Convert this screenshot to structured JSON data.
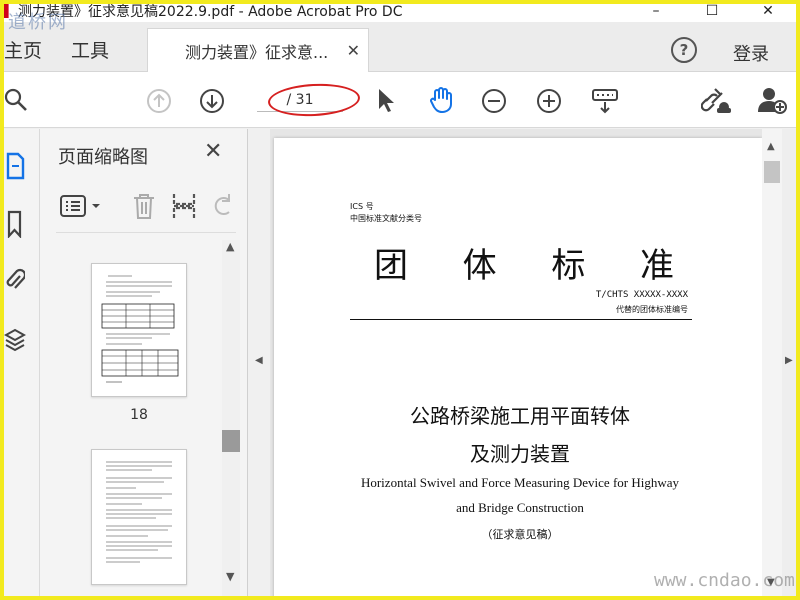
{
  "window": {
    "title": "测力装置》征求意见稿2022.9.pdf - Adobe Acrobat Pro DC",
    "minimize": "–",
    "maximize": "☐",
    "close": "✕"
  },
  "watermark_top": "道桥网",
  "tabs": {
    "home": "主页",
    "tools": "工具",
    "document": "测力装置》征求意...",
    "document_close": "✕"
  },
  "header": {
    "help": "?",
    "login": "登录"
  },
  "toolbar": {
    "page_indicator": "/ 31"
  },
  "thumbnails_panel": {
    "title": "页面缩略图",
    "close": "✕",
    "pages": [
      {
        "label": "18"
      },
      {
        "label": ""
      }
    ]
  },
  "document": {
    "ics": "ICS 号",
    "classification": "中国标准文献分类号",
    "title_chars": [
      "团",
      "体",
      "标",
      "准"
    ],
    "std_number": "T/CHTS XXXXX-XXXX",
    "std_number_note": "代替的团体标准编号",
    "cn_title_line1": "公路桥梁施工用平面转体",
    "cn_title_line2": "及测力装置",
    "en_title_line1": "Horizontal Swivel and Force Measuring Device for Highway",
    "en_title_line2": "and Bridge Construction",
    "draft_label": "（征求意见稿）"
  },
  "watermark_bottom": "www.cndao.com",
  "colors": {
    "frame": "#f2ea1e",
    "annotation": "#d62020",
    "active_icon": "#1473e6"
  }
}
